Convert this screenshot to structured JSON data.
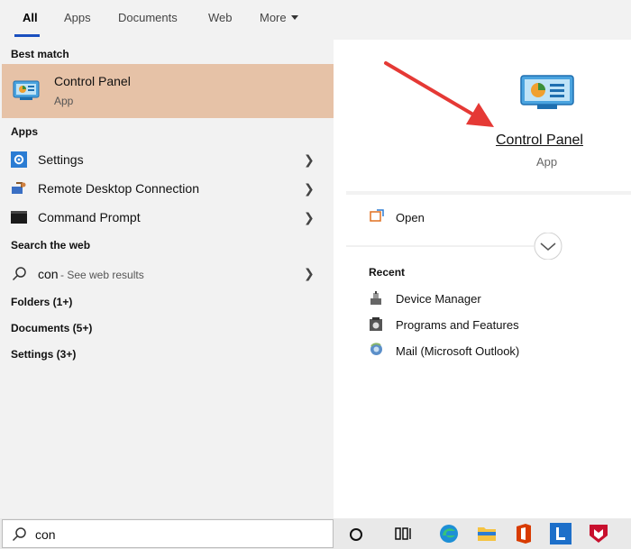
{
  "tabs": [
    {
      "label": "All"
    },
    {
      "label": "Apps"
    },
    {
      "label": "Documents"
    },
    {
      "label": "Web"
    },
    {
      "label": "More"
    }
  ],
  "left": {
    "best_match_title": "Best match",
    "best_match": {
      "title": "Control Panel",
      "subtitle": "App"
    },
    "apps_title": "Apps",
    "apps": [
      {
        "label": "Settings",
        "icon": "settings-gear-icon"
      },
      {
        "label": "Remote Desktop Connection",
        "icon": "remote-desktop-icon"
      },
      {
        "label": "Command Prompt",
        "icon": "command-prompt-icon"
      }
    ],
    "web_title": "Search the web",
    "web_item": {
      "query": "con",
      "suffix": " - See web results"
    },
    "categories": [
      {
        "label": "Folders (1+)"
      },
      {
        "label": "Documents (5+)"
      },
      {
        "label": "Settings (3+)"
      }
    ]
  },
  "right": {
    "app_title": "Control Panel",
    "app_subtitle": "App",
    "open_label": "Open",
    "recent_title": "Recent",
    "recent": [
      {
        "label": "Device Manager"
      },
      {
        "label": "Programs and Features"
      },
      {
        "label": "Mail (Microsoft Outlook)"
      }
    ]
  },
  "search": {
    "value": "con"
  },
  "taskbar": {
    "icons": [
      "cortana-icon",
      "task-view-icon",
      "edge-icon",
      "file-explorer-icon",
      "office-icon",
      "l-app-icon",
      "mcafee-icon"
    ]
  },
  "colors": {
    "highlight": "#e6c2a7",
    "accent": "#1a4fbf",
    "arrow": "#e53935"
  }
}
